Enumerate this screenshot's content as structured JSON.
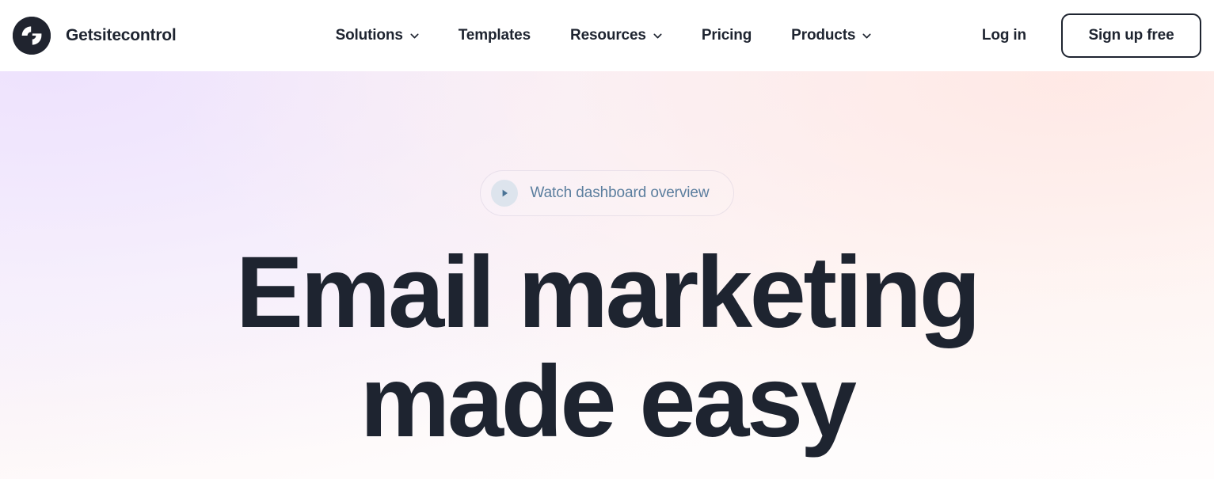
{
  "brand": {
    "logo_icon": "getsitecontrol-g-logo-icon",
    "name": "Getsitecontrol"
  },
  "nav": {
    "items": [
      {
        "label": "Solutions",
        "has_dropdown": true,
        "icon": "chevron-down-icon"
      },
      {
        "label": "Templates",
        "has_dropdown": false,
        "icon": ""
      },
      {
        "label": "Resources",
        "has_dropdown": true,
        "icon": "chevron-down-icon"
      },
      {
        "label": "Pricing",
        "has_dropdown": false,
        "icon": ""
      },
      {
        "label": "Products",
        "has_dropdown": true,
        "icon": "chevron-down-icon"
      }
    ]
  },
  "header_actions": {
    "login_label": "Log in",
    "signup_label": "Sign up free"
  },
  "hero": {
    "watch_pill": {
      "label": "Watch dashboard overview",
      "icon": "play-icon"
    },
    "title_line_1": "Email marketing",
    "title_line_2": "made easy"
  },
  "colors": {
    "header_background": "#ffffff",
    "text_dark": "#1e2430",
    "logo_background": "#20242f",
    "watch_text": "#5b7e9e",
    "play_circle_background": "#dde4ed",
    "play_triangle": "#4a7396",
    "hero_gradient_lavender": "#f3edfd",
    "hero_gradient_pink": "#fef6f4",
    "hero_gradient_white": "#fffdfd",
    "signup_border": "#1e2430"
  }
}
